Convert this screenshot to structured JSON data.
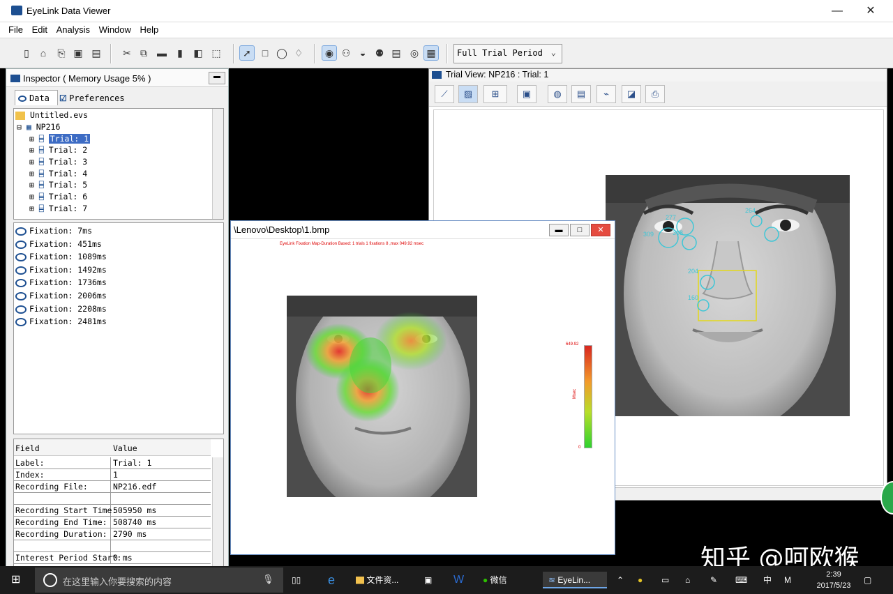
{
  "window": {
    "title": "EyeLink Data Viewer",
    "minimize": "—",
    "close": "✕"
  },
  "menu": [
    "File",
    "Edit",
    "Analysis",
    "Window",
    "Help"
  ],
  "toolbar": {
    "period_select": "Full Trial Period"
  },
  "inspector": {
    "title": "Inspector ( Memory Usage 5% )",
    "tabs": {
      "data": "Data",
      "preferences": "Preferences"
    },
    "tree": {
      "root": "Untitled.evs",
      "session": "NP216",
      "trials": [
        "Trial: 1",
        "Trial: 2",
        "Trial: 3",
        "Trial: 4",
        "Trial: 5",
        "Trial: 6",
        "Trial: 7"
      ]
    },
    "events": [
      "Fixation: 7ms",
      "Fixation: 451ms",
      "Fixation: 1089ms",
      "Fixation: 1492ms",
      "Fixation: 1736ms",
      "Fixation: 2006ms",
      "Fixation: 2208ms",
      "Fixation: 2481ms"
    ],
    "properties": {
      "header": {
        "field": "Field",
        "value": "Value"
      },
      "rows": [
        {
          "field": "Label:",
          "value": "Trial: 1"
        },
        {
          "field": "Index:",
          "value": "1"
        },
        {
          "field": "Recording File:",
          "value": "NP216.edf"
        },
        {
          "field": "",
          "value": ""
        },
        {
          "field": "Recording Start Time:",
          "value": "505950 ms"
        },
        {
          "field": "Recording End Time:",
          "value": "508740 ms"
        },
        {
          "field": "Recording Duration:",
          "value": "2790 ms"
        },
        {
          "field": "",
          "value": ""
        },
        {
          "field": "Interest Period Start:",
          "value": "0 ms"
        }
      ]
    }
  },
  "trial_view": {
    "title": "Trial View: NP216 : Trial: 1"
  },
  "heatmap_window": {
    "title": "\\Lenovo\\Desktop\\1.bmp",
    "caption": "EyeLink Fixation Map-Duration Based: 1 trials  1 fixations  8 ,max  049.92 msec",
    "scale_max": "649.92",
    "scale_min": "0",
    "scale_label": "Msec"
  },
  "fixation_labels": [
    "277",
    "309",
    "308",
    "264",
    "204",
    "160"
  ],
  "taskbar": {
    "search_placeholder": "在这里输入你要搜索的内容",
    "apps": [
      "文件资...",
      "微信",
      "EyeLin..."
    ],
    "ime": "中",
    "ime2": "M",
    "time": "2:39",
    "date": "2017/5/23"
  },
  "watermark": "知乎 @呵欧猴",
  "colors": {
    "accent": "#1d4f91",
    "heat_high": "#e4312b",
    "heat_low": "#3ad13a",
    "fixation": "#3fc6d6",
    "aoi": "#e3d81a"
  }
}
